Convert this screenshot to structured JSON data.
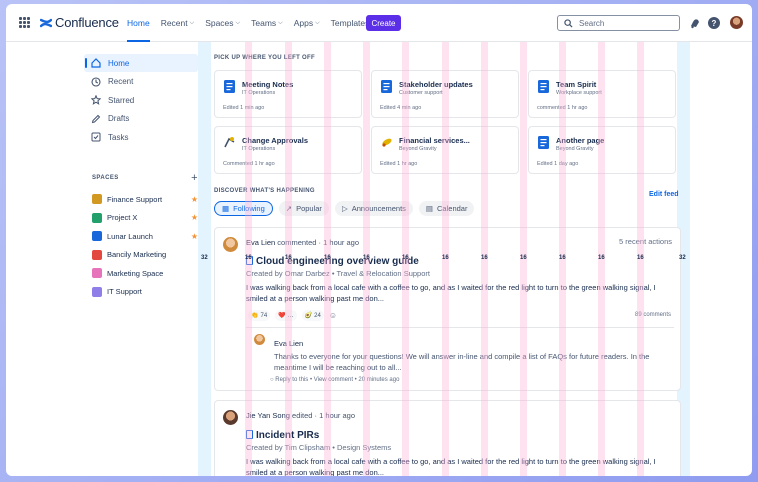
{
  "nav": {
    "logo_text": "Confluence",
    "items": [
      {
        "label": "Home",
        "caret": false,
        "active": true
      },
      {
        "label": "Recent",
        "caret": true
      },
      {
        "label": "Spaces",
        "caret": true
      },
      {
        "label": "Teams",
        "caret": true
      },
      {
        "label": "Apps",
        "caret": true
      },
      {
        "label": "Templates",
        "caret": false
      }
    ],
    "create_label": "Create",
    "search_placeholder": "Search",
    "icons": [
      "notification-icon",
      "help-icon",
      "profile-avatar"
    ]
  },
  "sidebar": {
    "items": [
      {
        "label": "Home",
        "icon": "home-icon",
        "active": true
      },
      {
        "label": "Recent",
        "icon": "clock-icon"
      },
      {
        "label": "Starred",
        "icon": "star-icon"
      },
      {
        "label": "Drafts",
        "icon": "pencil-icon"
      },
      {
        "label": "Tasks",
        "icon": "checkbox-icon"
      }
    ],
    "spaces_heading": "SPACES",
    "add_label": "+",
    "spaces": [
      {
        "label": "Finance Support",
        "color": "#d29922",
        "starred": true
      },
      {
        "label": "Project X",
        "color": "#22a06b",
        "starred": true
      },
      {
        "label": "Lunar Launch",
        "color": "#1868db",
        "starred": true
      },
      {
        "label": "Bancily Marketing",
        "color": "#e2483d",
        "starred": false
      },
      {
        "label": "Marketing Space",
        "color": "#e774bb",
        "starred": false
      },
      {
        "label": "IT Support",
        "color": "#8f7ee7",
        "starred": false
      }
    ]
  },
  "main": {
    "pickup_heading": "PICK UP WHERE YOU LEFT OFF",
    "recent_cards": [
      {
        "title": "Meeting Notes",
        "space": "IT Operations",
        "meta": "Edited 1 min ago",
        "icon": "page-icon"
      },
      {
        "title": "Stakeholder updates",
        "space": "Customer support",
        "meta": "Edited 4 min ago",
        "icon": "page-icon"
      },
      {
        "title": "Team Spirit",
        "space": "Workplace support",
        "meta": "commented 1 hr ago",
        "icon": "page-icon"
      },
      {
        "title": "Change Approvals",
        "space": "IT Operations",
        "meta": "Commented 1 hr ago",
        "icon": "whiteboard-icon"
      },
      {
        "title": "Financial services...",
        "space": "Beyond Gravity",
        "meta": "Edited 1 hr ago",
        "icon": "rocket-icon"
      },
      {
        "title": "Another page",
        "space": "Beyond Gravity",
        "meta": "Edited 1 day ago",
        "icon": "page-icon"
      }
    ],
    "discover_heading": "DISCOVER WHAT'S HAPPENING",
    "edit_feed_label": "Edit feed",
    "filters": [
      {
        "label": "Following",
        "active": true
      },
      {
        "label": "Popular"
      },
      {
        "label": "Announcements"
      },
      {
        "label": "Calendar"
      }
    ],
    "feed": [
      {
        "author": "Eva Lien",
        "action": "commented",
        "time": "1 hour ago",
        "right": "5 recent actions",
        "title": "Cloud engineering overview guide",
        "meta": "Created by Omar Darbez • Travel & Relocation Support",
        "body": "I was walking back from a local cafe with a coffee to go, and as I waited for the red light to turn to the green walking signal, I smiled at a person walking past me don...",
        "reactions": [
          {
            "emoji": "👏",
            "count": "74"
          },
          {
            "emoji": "❤️",
            "count": "…"
          },
          {
            "emoji": "🥑",
            "count": "24"
          }
        ],
        "comments_count": "89 comments",
        "reply": {
          "author": "Eva Lien",
          "body": "Thanks to everyone for your questions! We will answer in-line and compile a list of FAQs for future readers. In the meantime I will be reaching out to all...",
          "meta": "Reply to this • View comment • 20 minutes ago"
        }
      },
      {
        "author": "Jie Yan Song",
        "action": "edited",
        "time": "1 hour ago",
        "title": "Incident PIRs",
        "meta": "Created by Tim Clipsham • Design Systems",
        "body": "I was walking back from a local cafe with a coffee to go, and as I waited for the red light to turn to the green walking signal, I smiled at a person walking past me don..."
      }
    ]
  },
  "guides": {
    "margin_label": "32",
    "gutter_label": "16"
  }
}
